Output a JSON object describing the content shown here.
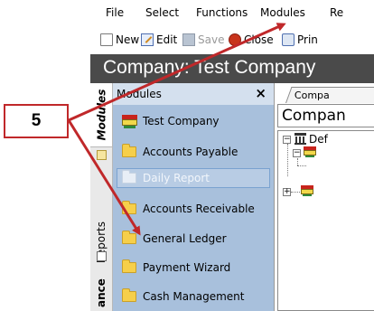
{
  "menu": {
    "items": [
      "File",
      "Select",
      "Functions",
      "Modules",
      "Re"
    ]
  },
  "toolbar": {
    "new_label": "New",
    "edit_label": "Edit",
    "save_label": "Save",
    "close_label": "Close",
    "print_label": "Prin"
  },
  "window": {
    "title": "Company: Test Company"
  },
  "side_tabs": {
    "modules": "Modules",
    "reports": "Reports",
    "maintenance": "ance"
  },
  "modules_panel": {
    "title": "Modules",
    "close_glyph": "×",
    "items": [
      "Test Company",
      "Accounts Payable",
      "Daily Report",
      "Accounts Receivable",
      "General Ledger",
      "Payment Wizard",
      "Cash Management"
    ]
  },
  "content": {
    "tab_label": "Compa",
    "header_text": "Compan",
    "tree_root_label": "Def"
  },
  "annotation": {
    "step_number": "5"
  },
  "colors": {
    "title_bar": "#4a4a4a",
    "modules_panel": "#a8c0dc",
    "annotation_red": "#c0282a"
  }
}
